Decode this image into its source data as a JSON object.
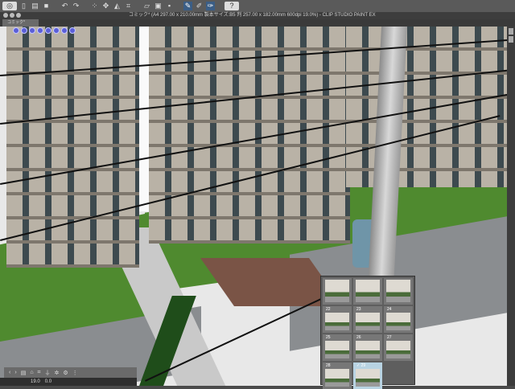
{
  "toolbar": {
    "icons": [
      "clip-studio-icon",
      "new-icon",
      "open-icon",
      "save-icon",
      "undo-icon",
      "redo-icon",
      "transform-icon",
      "move-icon",
      "fill-icon",
      "crop-icon",
      "ruler-icon",
      "layer-icon",
      "snap-icon",
      "pen-icon",
      "pen-pressure-icon",
      "brush-icon",
      "help-icon"
    ]
  },
  "window": {
    "title": "コミック* (A4 297.00 x 210.00mm 製本サイズ:B5 判 257.00 x 182.00mm 600dpi 19.0%) - CLIP STUDIO PAINT EX"
  },
  "tab": {
    "label": "コミック*"
  },
  "status": {
    "zoom": "19.0",
    "angle": "0.0"
  },
  "thumbnails": [
    "",
    "",
    "",
    "22",
    "23",
    "24",
    "25",
    "26",
    "27",
    "28",
    "✓ 29"
  ],
  "colors": {
    "accent": "#3b5e86",
    "grass": "#4f8a2f"
  }
}
